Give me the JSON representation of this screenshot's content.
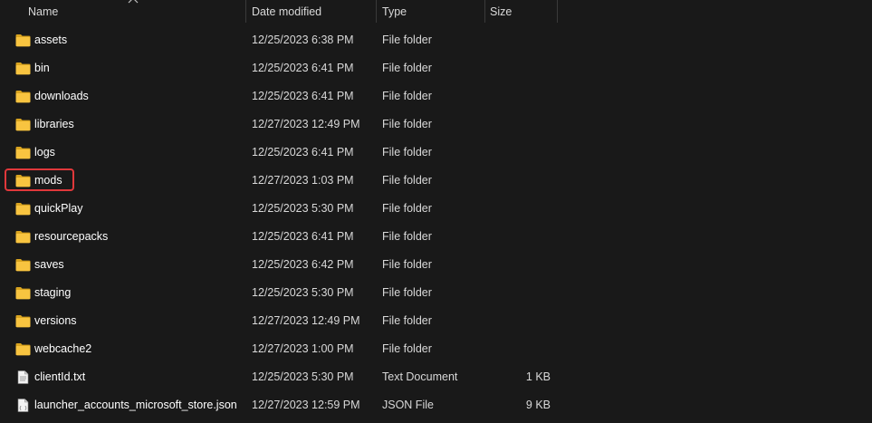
{
  "columns": {
    "name": "Name",
    "date": "Date modified",
    "type": "Type",
    "size": "Size"
  },
  "sort": {
    "column": "name",
    "icon": "sort-ascending-chevron-icon"
  },
  "colors": {
    "background": "#191919",
    "folder": "#f8c440",
    "highlight": "#e0383b"
  },
  "files": [
    {
      "name": "assets",
      "date": "12/25/2023 6:38 PM",
      "type": "File folder",
      "size": "",
      "icon": "folder-icon"
    },
    {
      "name": "bin",
      "date": "12/25/2023 6:41 PM",
      "type": "File folder",
      "size": "",
      "icon": "folder-icon"
    },
    {
      "name": "downloads",
      "date": "12/25/2023 6:41 PM",
      "type": "File folder",
      "size": "",
      "icon": "folder-icon"
    },
    {
      "name": "libraries",
      "date": "12/27/2023 12:49 PM",
      "type": "File folder",
      "size": "",
      "icon": "folder-icon"
    },
    {
      "name": "logs",
      "date": "12/25/2023 6:41 PM",
      "type": "File folder",
      "size": "",
      "icon": "folder-icon"
    },
    {
      "name": "mods",
      "date": "12/27/2023 1:03 PM",
      "type": "File folder",
      "size": "",
      "icon": "folder-icon",
      "highlighted": true
    },
    {
      "name": "quickPlay",
      "date": "12/25/2023 5:30 PM",
      "type": "File folder",
      "size": "",
      "icon": "folder-icon"
    },
    {
      "name": "resourcepacks",
      "date": "12/25/2023 6:41 PM",
      "type": "File folder",
      "size": "",
      "icon": "folder-icon"
    },
    {
      "name": "saves",
      "date": "12/25/2023 6:42 PM",
      "type": "File folder",
      "size": "",
      "icon": "folder-icon"
    },
    {
      "name": "staging",
      "date": "12/25/2023 5:30 PM",
      "type": "File folder",
      "size": "",
      "icon": "folder-icon"
    },
    {
      "name": "versions",
      "date": "12/27/2023 12:49 PM",
      "type": "File folder",
      "size": "",
      "icon": "folder-icon"
    },
    {
      "name": "webcache2",
      "date": "12/27/2023 1:00 PM",
      "type": "File folder",
      "size": "",
      "icon": "folder-icon"
    },
    {
      "name": "clientId.txt",
      "date": "12/25/2023 5:30 PM",
      "type": "Text Document",
      "size": "1 KB",
      "icon": "text-file-icon"
    },
    {
      "name": "launcher_accounts_microsoft_store.json",
      "date": "12/27/2023 12:59 PM",
      "type": "JSON File",
      "size": "9 KB",
      "icon": "json-file-icon"
    }
  ]
}
